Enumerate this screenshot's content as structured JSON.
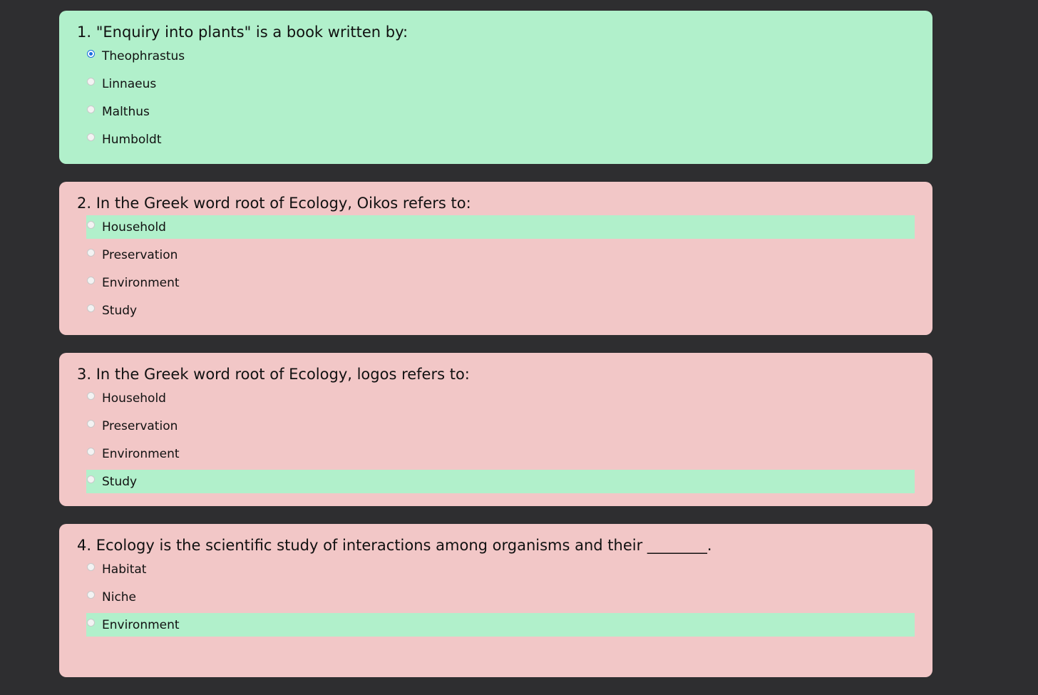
{
  "colors": {
    "page_background": "#2e2e30",
    "correct_background": "#b1f0cb",
    "wrong_background": "#f2c7c7",
    "correct_option_highlight": "#b1f0cb",
    "radio_selected": "#1a6fe0"
  },
  "questions": [
    {
      "text": "1. \"Enquiry into plants\" is a book written by:",
      "status": "correct",
      "options": [
        {
          "label": "Theophrastus",
          "selected": true,
          "highlight": false
        },
        {
          "label": "Linnaeus",
          "selected": false,
          "highlight": false
        },
        {
          "label": "Malthus",
          "selected": false,
          "highlight": false
        },
        {
          "label": "Humboldt",
          "selected": false,
          "highlight": false
        }
      ]
    },
    {
      "text": "2. In the Greek word root of Ecology, Oikos refers to:",
      "status": "wrong",
      "options": [
        {
          "label": "Household",
          "selected": false,
          "highlight": true
        },
        {
          "label": "Preservation",
          "selected": false,
          "highlight": false
        },
        {
          "label": "Environment",
          "selected": false,
          "highlight": false
        },
        {
          "label": "Study",
          "selected": false,
          "highlight": false
        }
      ]
    },
    {
      "text": "3. In the Greek word root of Ecology, logos refers to:",
      "status": "wrong",
      "options": [
        {
          "label": "Household",
          "selected": false,
          "highlight": false
        },
        {
          "label": "Preservation",
          "selected": false,
          "highlight": false
        },
        {
          "label": "Environment",
          "selected": false,
          "highlight": false
        },
        {
          "label": "Study",
          "selected": false,
          "highlight": true
        }
      ]
    },
    {
      "text": "4. Ecology is the scientific study of interactions among organisms and their ________.",
      "status": "wrong",
      "options": [
        {
          "label": "Habitat",
          "selected": false,
          "highlight": false
        },
        {
          "label": "Niche",
          "selected": false,
          "highlight": false
        },
        {
          "label": "Environment",
          "selected": false,
          "highlight": true
        }
      ]
    }
  ]
}
